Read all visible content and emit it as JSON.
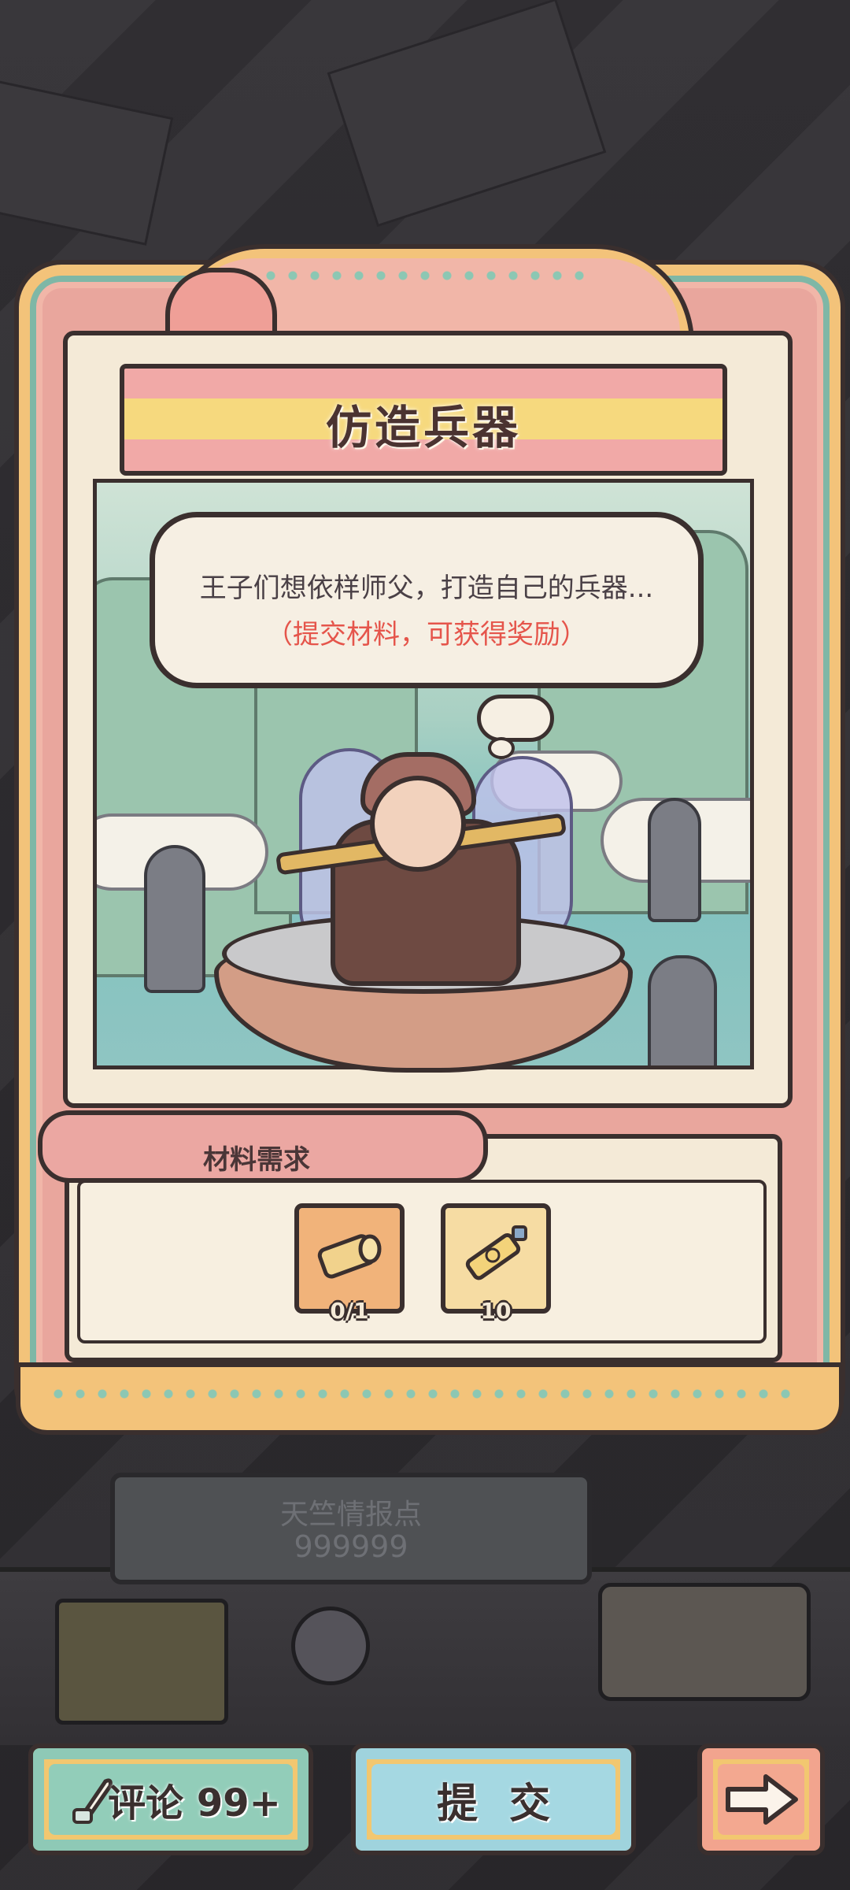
{
  "title": "仿造兵器",
  "speech": {
    "line1": "王子们想依样师父，打造自己的兵器...",
    "line2": "（提交材料，可获得奖励）"
  },
  "materials": {
    "label": "材料需求",
    "items": [
      {
        "icon": "wood-log-icon",
        "count": "0/1"
      },
      {
        "icon": "glue-tube-icon",
        "count": "10"
      }
    ]
  },
  "info": {
    "label": "天竺情报点",
    "value": "999999"
  },
  "buttons": {
    "comment": "评论 99+",
    "submit": "提交",
    "next": "arrow-right-icon"
  },
  "colors": {
    "accent_red": "#e5554b",
    "frame_pink": "#e9a69d",
    "frame_gold": "#f3c37a",
    "teal": "#8ec9b6"
  }
}
